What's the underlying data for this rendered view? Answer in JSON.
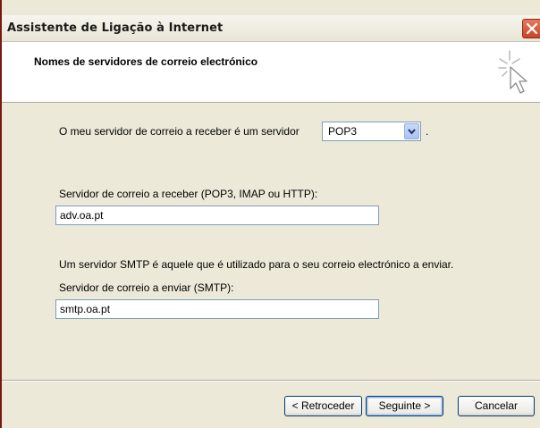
{
  "window": {
    "title": "Assistente de Ligação à Internet",
    "close_icon": "close-icon"
  },
  "header": {
    "title": "Nomes de servidores de correio electrónico",
    "icon": "wizard-cursor-icon"
  },
  "form": {
    "incoming_type_label": "O meu servidor de correio a receber é um servidor",
    "incoming_type_value": "POP3",
    "incoming_type_suffix": ".",
    "incoming_server_label": "Servidor de correio a receber (POP3, IMAP ou HTTP):",
    "incoming_server_value": "adv.oa.pt",
    "smtp_info": "Um servidor SMTP é aquele que é utilizado para o seu correio electrónico a enviar.",
    "outgoing_server_label": "Servidor de correio a enviar (SMTP):",
    "outgoing_server_value": "smtp.oa.pt"
  },
  "buttons": {
    "back": "< Retroceder",
    "next": "Seguinte >",
    "cancel": "Cancelar"
  },
  "colors": {
    "title_close": "#c8452b",
    "window_face": "#ece9d8",
    "input_border": "#7f9db9"
  }
}
